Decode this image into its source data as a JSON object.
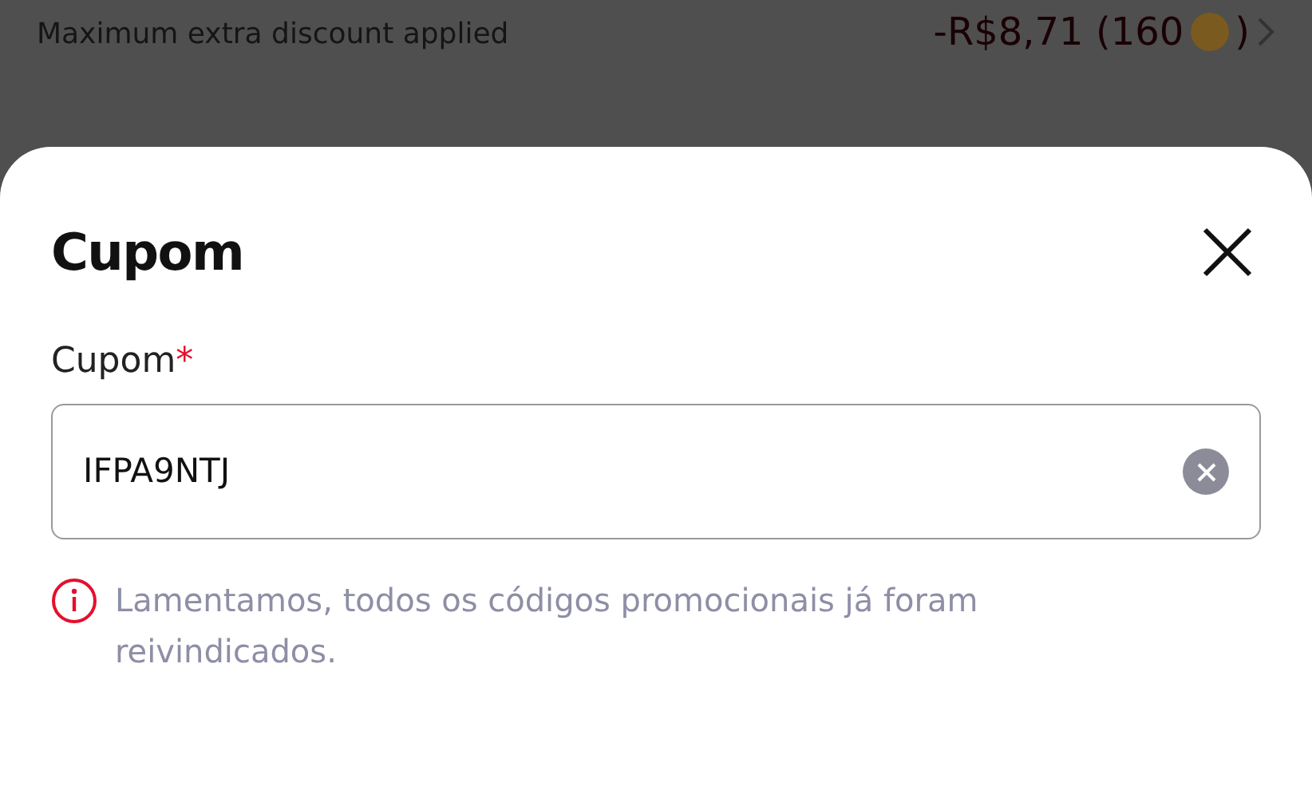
{
  "background": {
    "discount_note": "Maximum extra discount applied",
    "discount_amount": "-R$8,71 (160",
    "discount_amount_end": ")"
  },
  "sheet": {
    "title": "Cupom",
    "field": {
      "label": "Cupom",
      "required_mark": "*",
      "value": "IFPA9NTJ"
    },
    "error": "Lamentamos, todos os códigos promocionais já foram reivindicados."
  }
}
